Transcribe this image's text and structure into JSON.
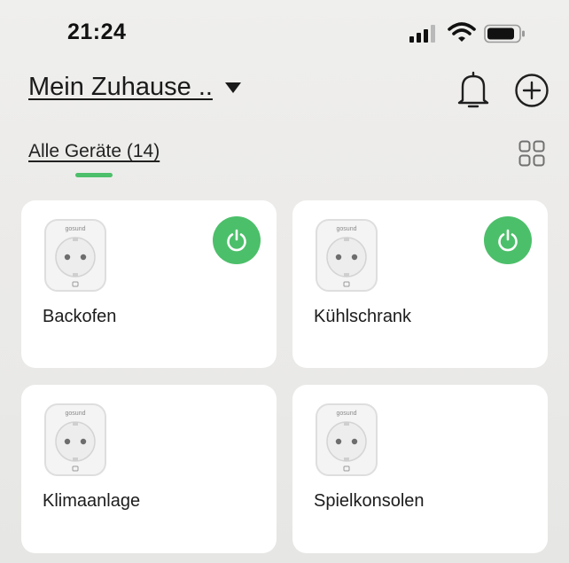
{
  "status_bar": {
    "time": "21:24",
    "signal_icon": "cellular-signal-icon",
    "wifi_icon": "wifi-icon",
    "battery_icon": "battery-icon"
  },
  "header": {
    "home_name": "Mein Zuhause ..",
    "caret_icon": "caret-down-icon",
    "notification_icon": "bell-icon",
    "add_icon": "plus-circle-icon"
  },
  "tab": {
    "label": "Alle Geräte (14)",
    "indicator_color": "#4cbf6a",
    "view_icon": "grid-view-icon"
  },
  "devices": [
    {
      "name": "Backofen",
      "image_icon": "smart-plug-icon",
      "power_icon": "power-icon",
      "power_on": true
    },
    {
      "name": "Kühlschrank",
      "image_icon": "smart-plug-icon",
      "power_icon": "power-icon",
      "power_on": true
    },
    {
      "name": "Klimaanlage",
      "image_icon": "smart-plug-icon",
      "power_on": false
    },
    {
      "name": "Spielkonsolen",
      "image_icon": "smart-plug-icon",
      "power_on": false
    }
  ],
  "colors": {
    "accent_green": "#4cbf6a",
    "card_bg": "#ffffff",
    "text": "#1c1c1c"
  }
}
